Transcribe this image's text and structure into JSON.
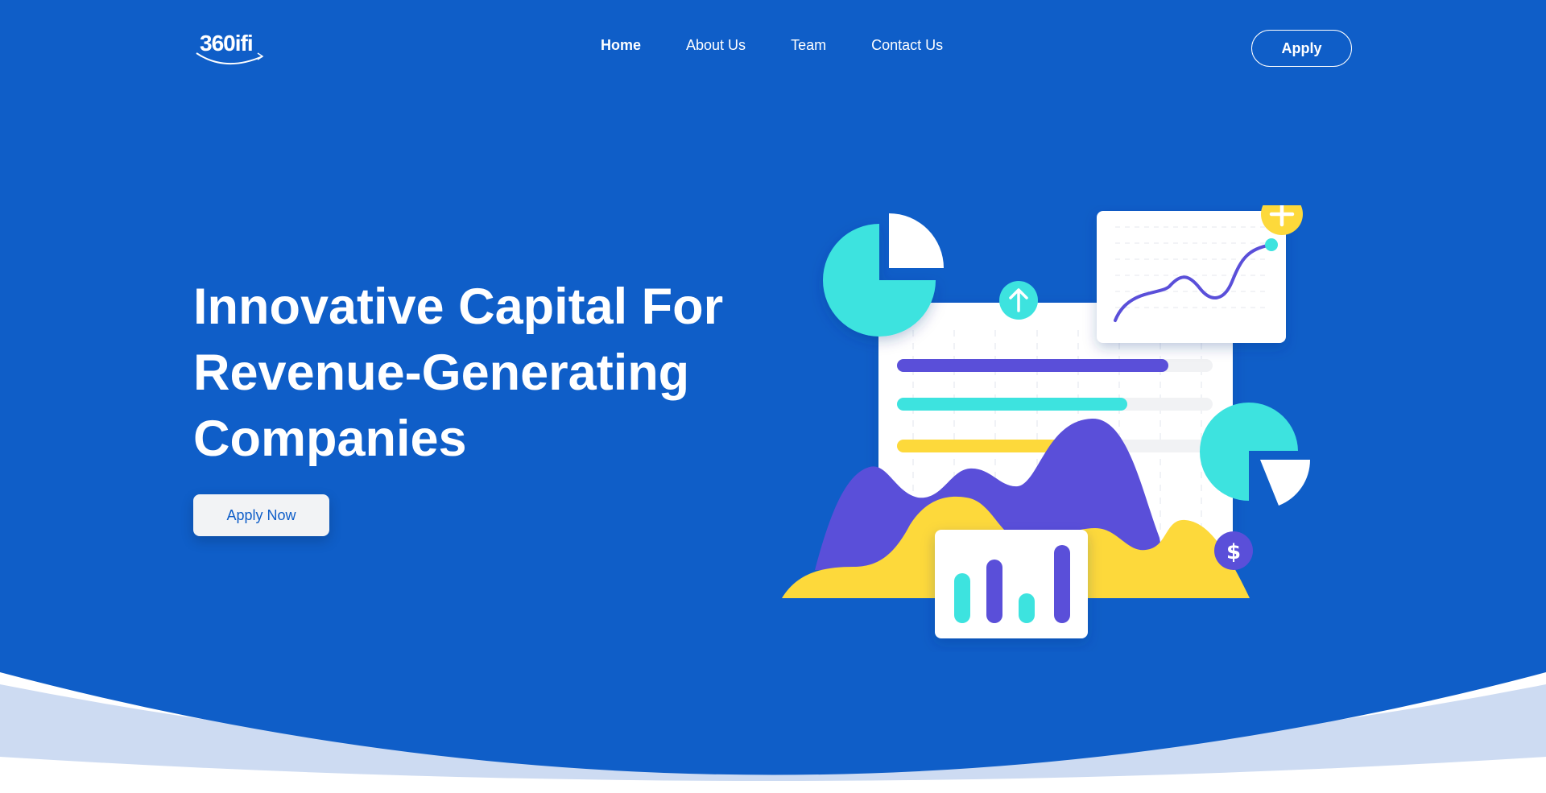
{
  "brand": {
    "logo_text": "360ifi"
  },
  "nav": {
    "items": [
      {
        "label": "Home",
        "active": true
      },
      {
        "label": "About Us",
        "active": false
      },
      {
        "label": "Team",
        "active": false
      },
      {
        "label": "Contact Us",
        "active": false
      }
    ],
    "cta_label": "Apply"
  },
  "hero": {
    "headline_lines": [
      "Innovative Capital For",
      "Revenue-Generating",
      "Companies"
    ],
    "cta_label": "Apply Now"
  },
  "illustration": {
    "icons": [
      "pie-chart-icon",
      "arrow-up-icon",
      "line-chart-icon",
      "plus-icon",
      "dollar-icon",
      "bar-chart-icon"
    ],
    "progress_bars": [
      {
        "color": "#5a4fd9",
        "value": 0.86
      },
      {
        "color": "#3de3df",
        "value": 0.73
      },
      {
        "color": "#fdd93b",
        "value": 0.52
      }
    ]
  },
  "colors": {
    "primary_blue": "#0f5ec8",
    "wave_light": "#cddbf2",
    "purple": "#5a4fd9",
    "teal": "#3de3df",
    "yellow": "#fdd93b",
    "white": "#ffffff"
  }
}
